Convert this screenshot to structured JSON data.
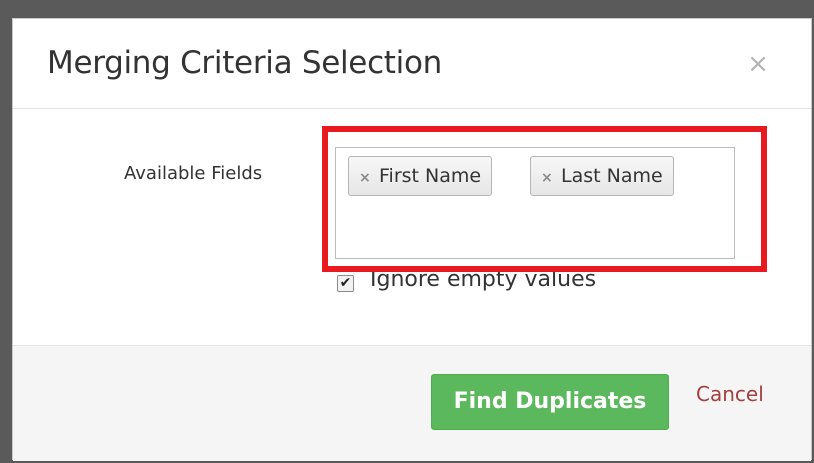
{
  "dialog": {
    "title": "Merging Criteria Selection",
    "close_symbol": "×"
  },
  "form": {
    "available_fields_label": "Available Fields",
    "selected_fields": [
      {
        "label": "First Name",
        "remove_symbol": "×"
      },
      {
        "label": "Last Name",
        "remove_symbol": "×"
      }
    ],
    "ignore_empty": {
      "label": "Ignore empty values",
      "checked": true,
      "check_symbol": "✔"
    }
  },
  "footer": {
    "primary_label": "Find Duplicates",
    "cancel_label": "Cancel"
  },
  "colors": {
    "primary": "#5cb85c",
    "highlight": "#e8191f",
    "cancel": "#a33f3f"
  },
  "icons": {
    "close": "close-icon",
    "remove_tag": "remove-tag-icon",
    "checkmark": "checkmark-icon"
  }
}
